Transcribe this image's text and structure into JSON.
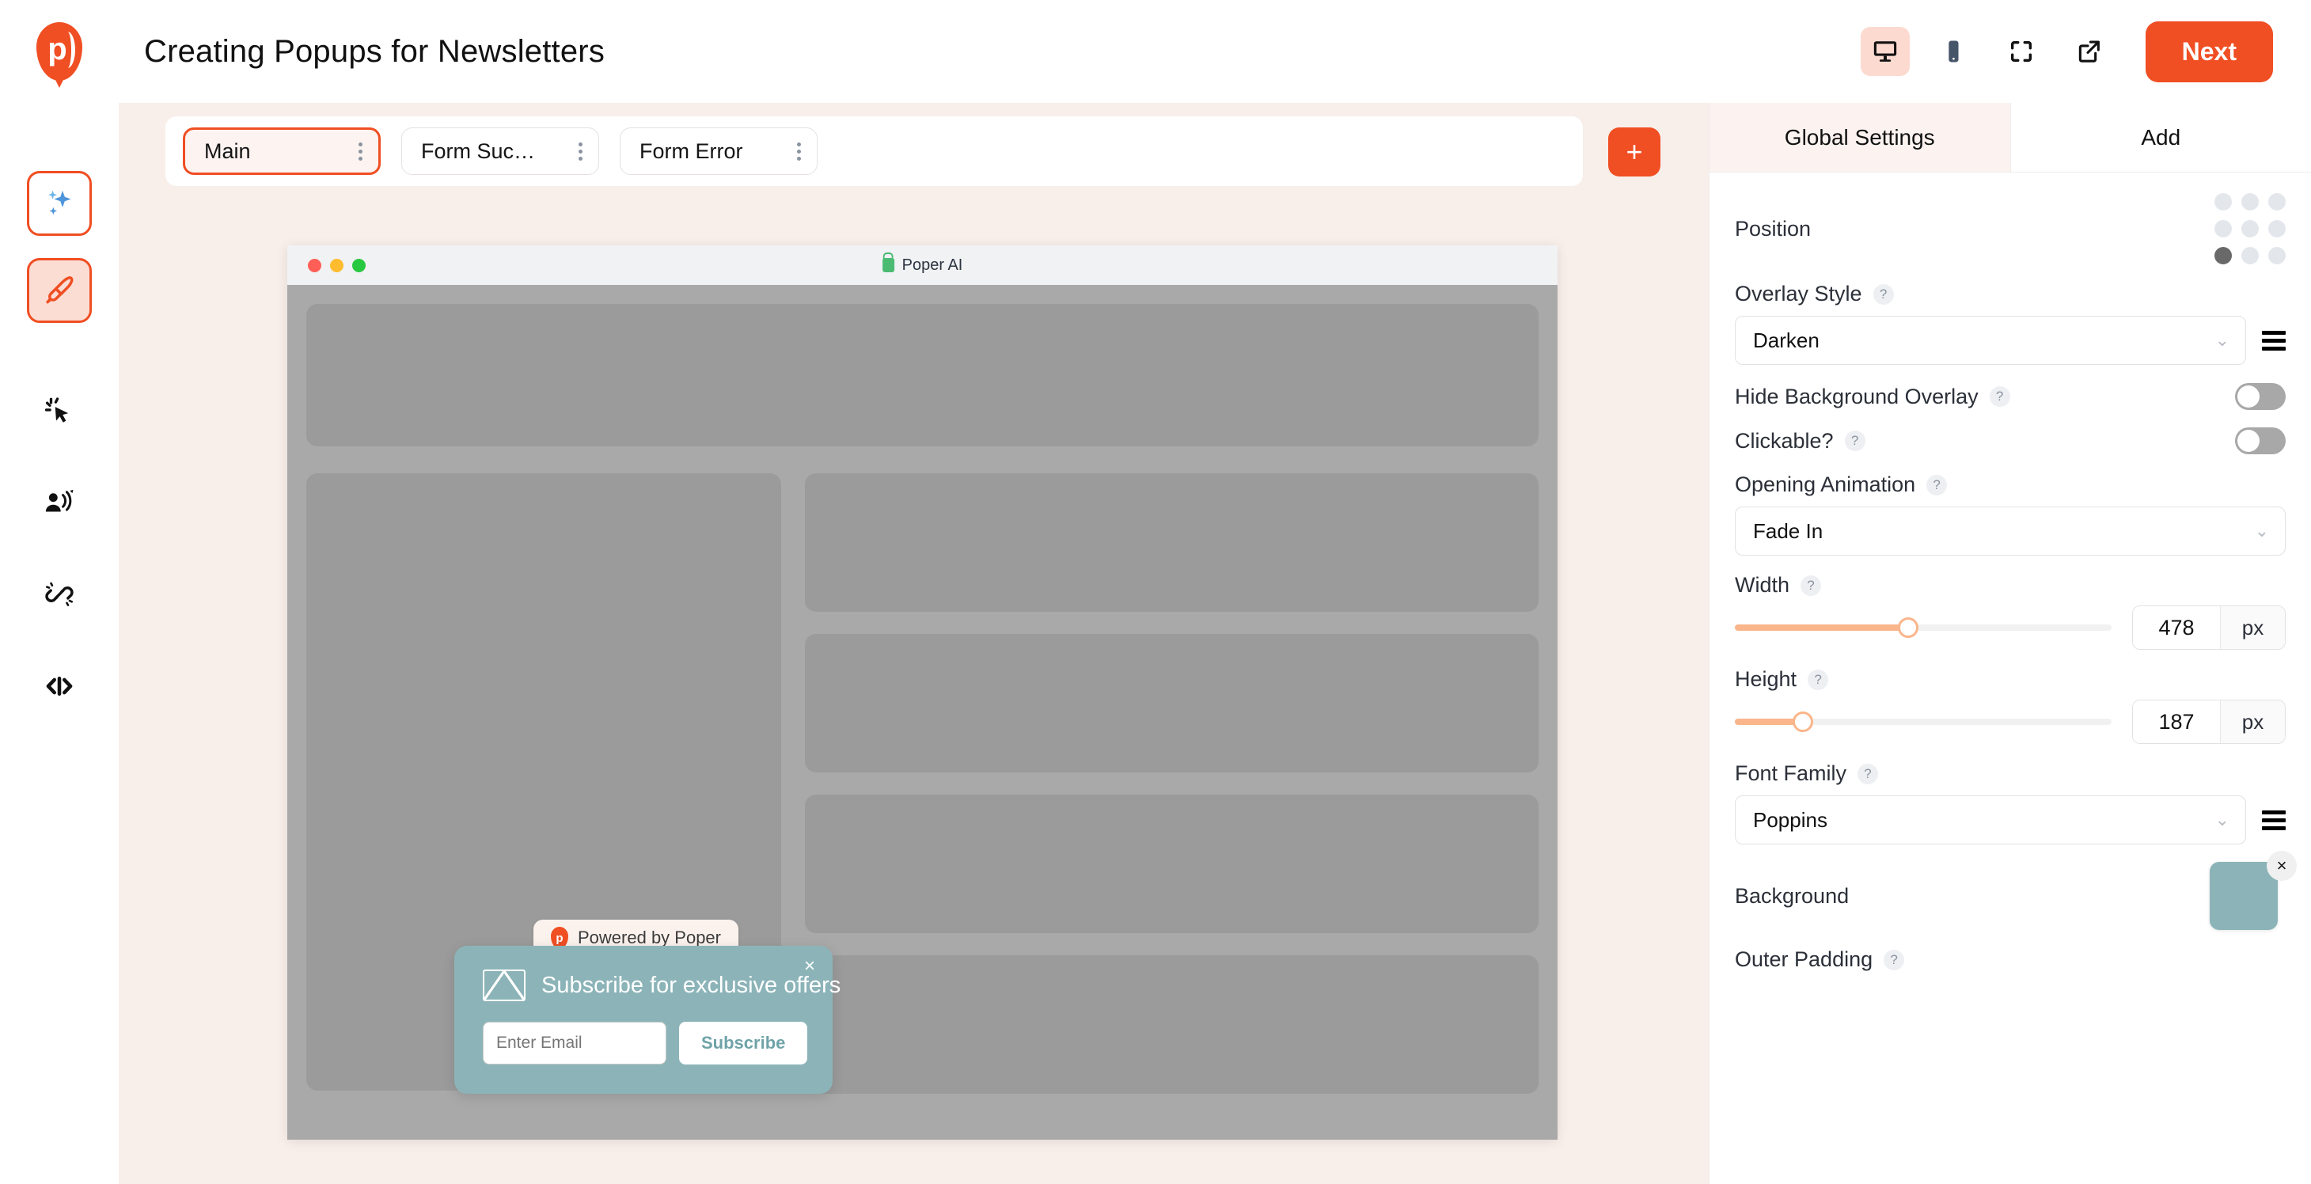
{
  "header": {
    "title": "Creating Popups for Newsletters",
    "logo_icon": "poper-balloon-logo",
    "logo_letter": "p",
    "devices": [
      {
        "icon": "desktop-icon",
        "active": true
      },
      {
        "icon": "mobile-icon",
        "active": false
      },
      {
        "icon": "fullscreen-icon",
        "active": false
      },
      {
        "icon": "external-link-icon",
        "active": false
      }
    ],
    "next_label": "Next"
  },
  "sidebar": {
    "items": [
      {
        "icon": "ai-sparkle-icon",
        "state": "outlined"
      },
      {
        "icon": "paintbrush-icon",
        "state": "filled"
      },
      {
        "icon": "cursor-click-icon",
        "state": "plain"
      },
      {
        "icon": "audience-targeting-icon",
        "state": "plain"
      },
      {
        "icon": "link-magnet-icon",
        "state": "plain"
      },
      {
        "icon": "code-icon",
        "state": "plain"
      }
    ]
  },
  "canvas": {
    "tabs": [
      {
        "label": "Main",
        "active": true,
        "menu_icon": "vertical-dots-icon"
      },
      {
        "label": "Form Suc…",
        "active": false,
        "menu_icon": "vertical-dots-icon"
      },
      {
        "label": "Form Error",
        "active": false,
        "menu_icon": "vertical-dots-icon"
      }
    ],
    "add_tab_label": "+",
    "browser": {
      "traffic_lights": [
        "red",
        "yellow",
        "green"
      ],
      "lock_icon": "green-lock-icon",
      "site_name": "Poper AI"
    },
    "powered_badge": {
      "icon": "poper-balloon-logo",
      "logo_letter": "p",
      "text": "Powered by Poper"
    },
    "popup": {
      "close_label": "×",
      "envelope_icon": "envelope-icon",
      "title": "Subscribe for exclusive offers",
      "email_placeholder": "Enter Email",
      "email_value": "",
      "subscribe_label": "Subscribe",
      "background_color": "#8CB4B8"
    }
  },
  "panel": {
    "tabs": [
      {
        "label": "Global Settings",
        "active": true
      },
      {
        "label": "Add",
        "active": false
      }
    ],
    "settings": {
      "position": {
        "label": "Position",
        "selected_index": 6,
        "cells": [
          0,
          1,
          2,
          3,
          4,
          5,
          6,
          7,
          8
        ]
      },
      "overlay_style": {
        "label": "Overlay Style",
        "help": "?",
        "value": "Darken",
        "chevron": "⌄",
        "list_icon": "hamburger-icon"
      },
      "hide_background_overlay": {
        "label": "Hide Background Overlay",
        "help": "?",
        "enabled": false
      },
      "clickable": {
        "label": "Clickable?",
        "help": "?",
        "enabled": false
      },
      "opening_animation": {
        "label": "Opening Animation",
        "help": "?",
        "value": "Fade In",
        "chevron": "⌄"
      },
      "width": {
        "label": "Width",
        "help": "?",
        "value": "478",
        "unit": "px",
        "percent": 46
      },
      "height": {
        "label": "Height",
        "help": "?",
        "value": "187",
        "unit": "px",
        "percent": 18
      },
      "font_family": {
        "label": "Font Family",
        "help": "?",
        "value": "Poppins",
        "chevron": "⌄",
        "list_icon": "hamburger-icon"
      },
      "background": {
        "label": "Background",
        "color": "#8CB4B8",
        "remove_label": "×"
      },
      "outer_padding": {
        "label": "Outer Padding",
        "help": "?"
      }
    }
  },
  "theme": {
    "accent": "#F04E23",
    "accent_soft": "#FCDAD0",
    "canvas_bg": "#F8EEEA",
    "slider_fill": "#FAB58B"
  }
}
